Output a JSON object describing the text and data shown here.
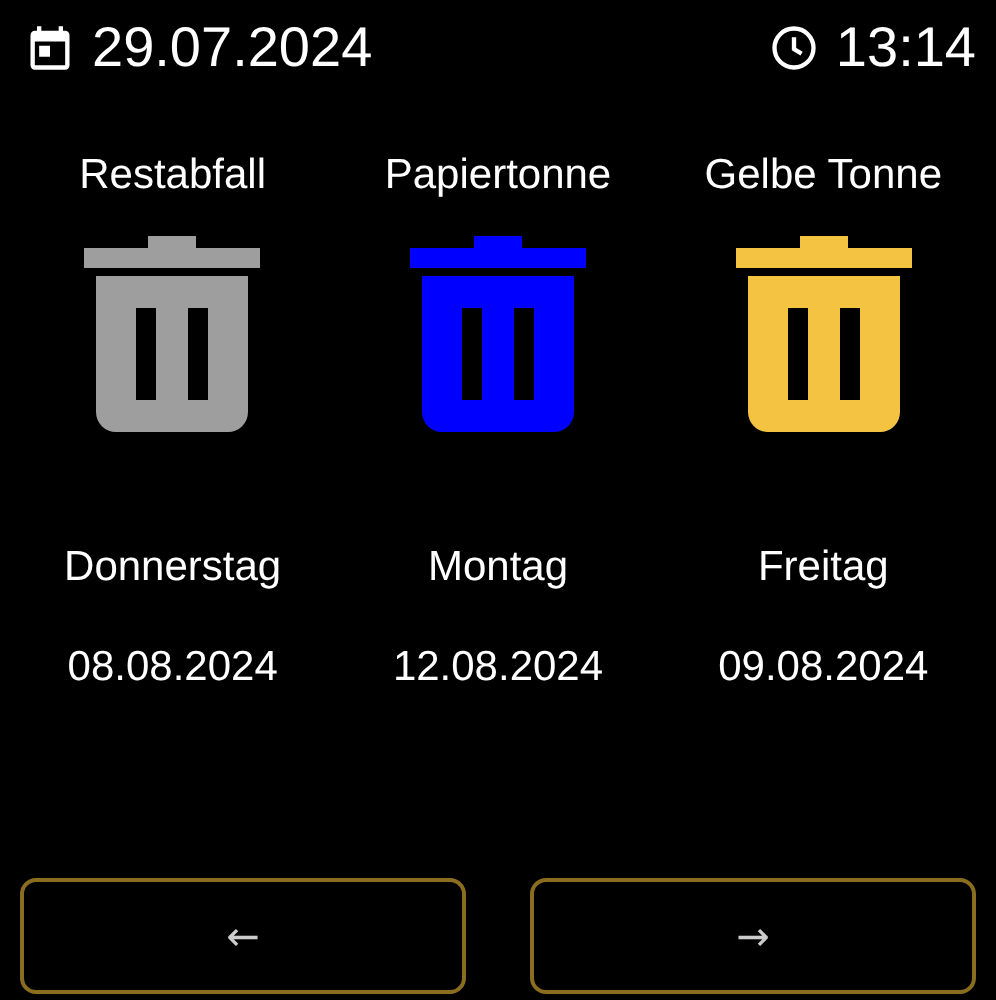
{
  "header": {
    "date": "29.07.2024",
    "time": "13:14"
  },
  "bins": [
    {
      "name": "Restabfall",
      "color": "#9e9e9e",
      "day": "Donnerstag",
      "date": "08.08.2024"
    },
    {
      "name": "Papiertonne",
      "color": "#0000ff",
      "day": "Montag",
      "date": "12.08.2024"
    },
    {
      "name": "Gelbe Tonne",
      "color": "#f5c342",
      "day": "Freitag",
      "date": "09.08.2024"
    }
  ],
  "buttons": [
    {
      "label": "←"
    },
    {
      "label": "→"
    }
  ]
}
